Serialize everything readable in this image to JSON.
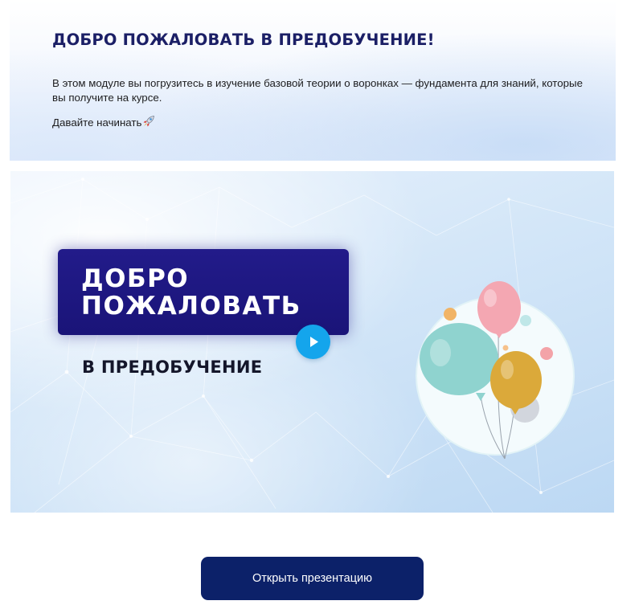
{
  "intro": {
    "title": "ДОБРО ПОЖАЛОВАТЬ В ПРЕДОБУЧЕНИЕ!",
    "text": "В этом модуле вы погрузитесь в изучение базовой теории о воронках — фундамента для знаний, которые вы получите на курсе.",
    "cta": "Давайте начинать",
    "cta_icon": "rocket-icon"
  },
  "video": {
    "title_line1": "ДОБРО",
    "title_line2": "ПОЖАЛОВАТЬ",
    "subtitle": "В ПРЕДОБУЧЕНИЕ",
    "play_icon": "play-icon",
    "illustration": "balloons-illustration"
  },
  "presentation_button": {
    "label": "Открыть презентацию"
  },
  "colors": {
    "title": "#1b1f66",
    "welcome_box": "#221b8a",
    "play_button": "#14a5ec",
    "primary_button": "#0c2169"
  }
}
